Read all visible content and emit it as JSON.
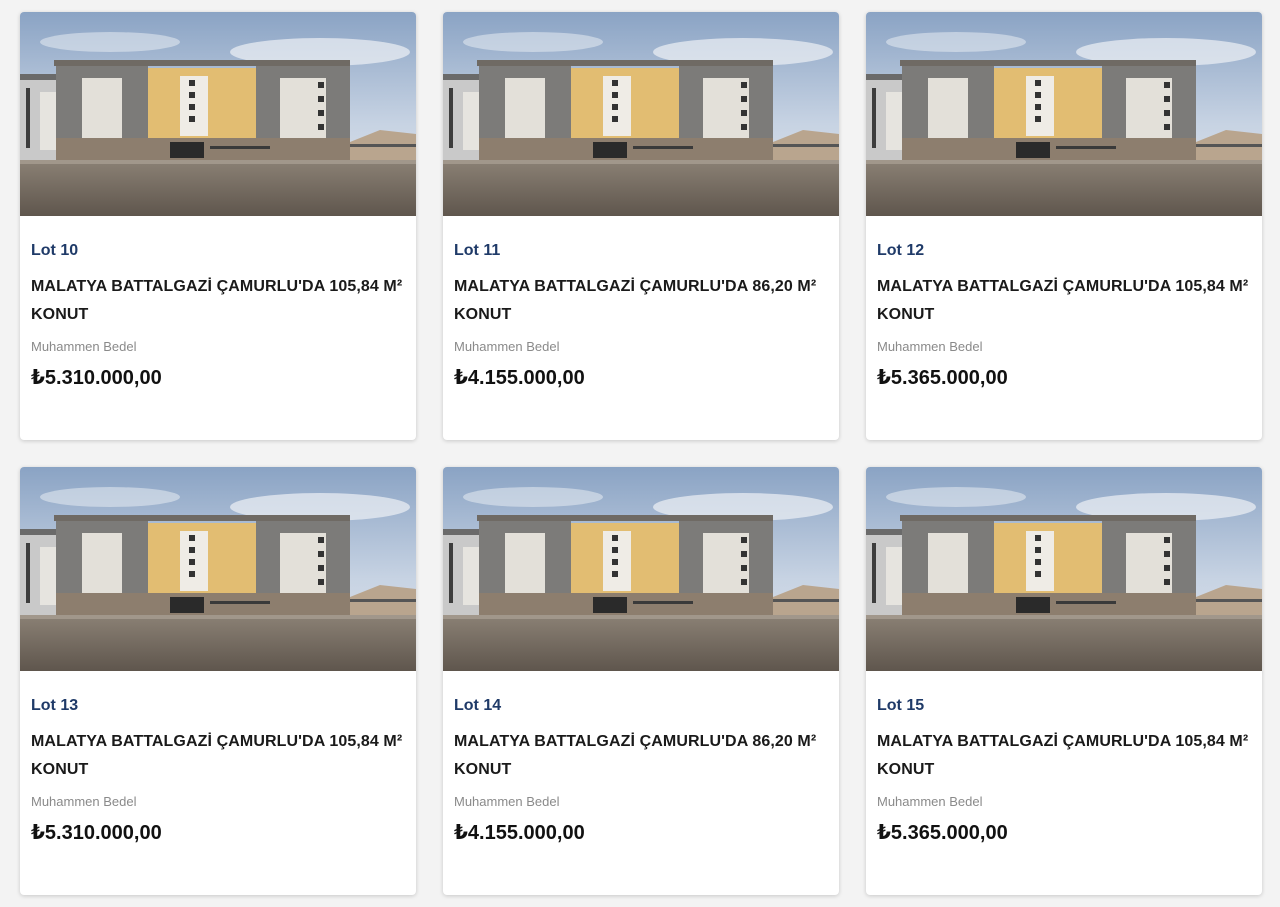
{
  "listings": [
    {
      "lot": "Lot 10",
      "title": "MALATYA BATTALGAZİ ÇAMURLU'DA 105,84 M² KONUT",
      "price_label": "Muhammen Bedel",
      "price": "₺5.310.000,00"
    },
    {
      "lot": "Lot 11",
      "title": "MALATYA BATTALGAZİ ÇAMURLU'DA 86,20 M² KONUT",
      "price_label": "Muhammen Bedel",
      "price": "₺4.155.000,00"
    },
    {
      "lot": "Lot 12",
      "title": "MALATYA BATTALGAZİ ÇAMURLU'DA 105,84 M² KONUT",
      "price_label": "Muhammen Bedel",
      "price": "₺5.365.000,00"
    },
    {
      "lot": "Lot 13",
      "title": "MALATYA BATTALGAZİ ÇAMURLU'DA 105,84 M² KONUT",
      "price_label": "Muhammen Bedel",
      "price": "₺5.310.000,00"
    },
    {
      "lot": "Lot 14",
      "title": "MALATYA BATTALGAZİ ÇAMURLU'DA 86,20 M² KONUT",
      "price_label": "Muhammen Bedel",
      "price": "₺4.155.000,00"
    },
    {
      "lot": "Lot 15",
      "title": "MALATYA BATTALGAZİ ÇAMURLU'DA 105,84 M² KONUT",
      "price_label": "Muhammen Bedel",
      "price": "₺5.365.000,00"
    }
  ],
  "colors": {
    "lot_accent": "#1f3a68",
    "page_background": "#f3f3f3",
    "card_background": "#ffffff"
  }
}
